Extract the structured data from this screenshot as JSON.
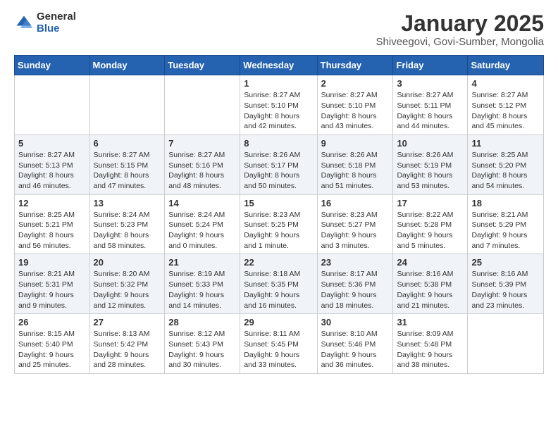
{
  "logo": {
    "general": "General",
    "blue": "Blue"
  },
  "title": "January 2025",
  "subtitle": "Shiveegovi, Govi-Sumber, Mongolia",
  "days_header": [
    "Sunday",
    "Monday",
    "Tuesday",
    "Wednesday",
    "Thursday",
    "Friday",
    "Saturday"
  ],
  "weeks": [
    [
      {
        "num": "",
        "info": ""
      },
      {
        "num": "",
        "info": ""
      },
      {
        "num": "",
        "info": ""
      },
      {
        "num": "1",
        "info": "Sunrise: 8:27 AM\nSunset: 5:10 PM\nDaylight: 8 hours and 42 minutes."
      },
      {
        "num": "2",
        "info": "Sunrise: 8:27 AM\nSunset: 5:10 PM\nDaylight: 8 hours and 43 minutes."
      },
      {
        "num": "3",
        "info": "Sunrise: 8:27 AM\nSunset: 5:11 PM\nDaylight: 8 hours and 44 minutes."
      },
      {
        "num": "4",
        "info": "Sunrise: 8:27 AM\nSunset: 5:12 PM\nDaylight: 8 hours and 45 minutes."
      }
    ],
    [
      {
        "num": "5",
        "info": "Sunrise: 8:27 AM\nSunset: 5:13 PM\nDaylight: 8 hours and 46 minutes."
      },
      {
        "num": "6",
        "info": "Sunrise: 8:27 AM\nSunset: 5:15 PM\nDaylight: 8 hours and 47 minutes."
      },
      {
        "num": "7",
        "info": "Sunrise: 8:27 AM\nSunset: 5:16 PM\nDaylight: 8 hours and 48 minutes."
      },
      {
        "num": "8",
        "info": "Sunrise: 8:26 AM\nSunset: 5:17 PM\nDaylight: 8 hours and 50 minutes."
      },
      {
        "num": "9",
        "info": "Sunrise: 8:26 AM\nSunset: 5:18 PM\nDaylight: 8 hours and 51 minutes."
      },
      {
        "num": "10",
        "info": "Sunrise: 8:26 AM\nSunset: 5:19 PM\nDaylight: 8 hours and 53 minutes."
      },
      {
        "num": "11",
        "info": "Sunrise: 8:25 AM\nSunset: 5:20 PM\nDaylight: 8 hours and 54 minutes."
      }
    ],
    [
      {
        "num": "12",
        "info": "Sunrise: 8:25 AM\nSunset: 5:21 PM\nDaylight: 8 hours and 56 minutes."
      },
      {
        "num": "13",
        "info": "Sunrise: 8:24 AM\nSunset: 5:23 PM\nDaylight: 8 hours and 58 minutes."
      },
      {
        "num": "14",
        "info": "Sunrise: 8:24 AM\nSunset: 5:24 PM\nDaylight: 9 hours and 0 minutes."
      },
      {
        "num": "15",
        "info": "Sunrise: 8:23 AM\nSunset: 5:25 PM\nDaylight: 9 hours and 1 minute."
      },
      {
        "num": "16",
        "info": "Sunrise: 8:23 AM\nSunset: 5:27 PM\nDaylight: 9 hours and 3 minutes."
      },
      {
        "num": "17",
        "info": "Sunrise: 8:22 AM\nSunset: 5:28 PM\nDaylight: 9 hours and 5 minutes."
      },
      {
        "num": "18",
        "info": "Sunrise: 8:21 AM\nSunset: 5:29 PM\nDaylight: 9 hours and 7 minutes."
      }
    ],
    [
      {
        "num": "19",
        "info": "Sunrise: 8:21 AM\nSunset: 5:31 PM\nDaylight: 9 hours and 9 minutes."
      },
      {
        "num": "20",
        "info": "Sunrise: 8:20 AM\nSunset: 5:32 PM\nDaylight: 9 hours and 12 minutes."
      },
      {
        "num": "21",
        "info": "Sunrise: 8:19 AM\nSunset: 5:33 PM\nDaylight: 9 hours and 14 minutes."
      },
      {
        "num": "22",
        "info": "Sunrise: 8:18 AM\nSunset: 5:35 PM\nDaylight: 9 hours and 16 minutes."
      },
      {
        "num": "23",
        "info": "Sunrise: 8:17 AM\nSunset: 5:36 PM\nDaylight: 9 hours and 18 minutes."
      },
      {
        "num": "24",
        "info": "Sunrise: 8:16 AM\nSunset: 5:38 PM\nDaylight: 9 hours and 21 minutes."
      },
      {
        "num": "25",
        "info": "Sunrise: 8:16 AM\nSunset: 5:39 PM\nDaylight: 9 hours and 23 minutes."
      }
    ],
    [
      {
        "num": "26",
        "info": "Sunrise: 8:15 AM\nSunset: 5:40 PM\nDaylight: 9 hours and 25 minutes."
      },
      {
        "num": "27",
        "info": "Sunrise: 8:13 AM\nSunset: 5:42 PM\nDaylight: 9 hours and 28 minutes."
      },
      {
        "num": "28",
        "info": "Sunrise: 8:12 AM\nSunset: 5:43 PM\nDaylight: 9 hours and 30 minutes."
      },
      {
        "num": "29",
        "info": "Sunrise: 8:11 AM\nSunset: 5:45 PM\nDaylight: 9 hours and 33 minutes."
      },
      {
        "num": "30",
        "info": "Sunrise: 8:10 AM\nSunset: 5:46 PM\nDaylight: 9 hours and 36 minutes."
      },
      {
        "num": "31",
        "info": "Sunrise: 8:09 AM\nSunset: 5:48 PM\nDaylight: 9 hours and 38 minutes."
      },
      {
        "num": "",
        "info": ""
      }
    ]
  ]
}
